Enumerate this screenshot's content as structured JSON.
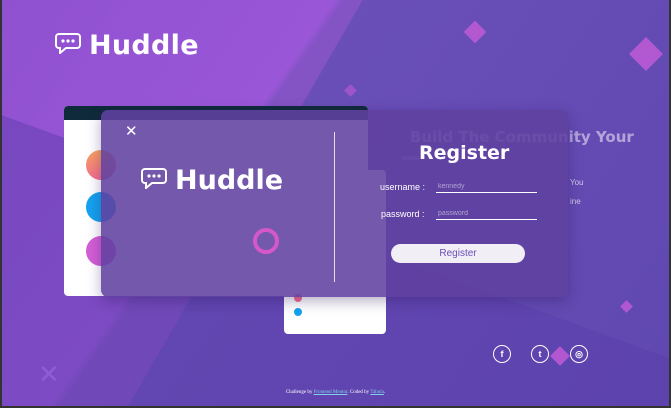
{
  "brand": {
    "name": "Huddle",
    "icon": "chat-bubble-icon"
  },
  "background_content": {
    "heading": "Build The Community Your",
    "text_lines": [
      "You",
      "ine"
    ]
  },
  "modal": {
    "close_icon": "close-icon",
    "brand_name": "Huddle",
    "title": "Register",
    "username_label": "username :",
    "username_placeholder": "kennedy",
    "password_label": "password :",
    "password_placeholder": "password",
    "submit_label": "Register"
  },
  "social": [
    {
      "icon": "facebook-icon",
      "glyph": "f"
    },
    {
      "icon": "twitter-icon",
      "glyph": "t"
    },
    {
      "icon": "instagram-icon",
      "glyph": "◎"
    }
  ],
  "attribution": {
    "prefix": "Challenge by",
    "challenge_link": "Frontend Mentor",
    "middle": ". Coded by",
    "author_link": "Tabula",
    "suffix": "."
  },
  "colors": {
    "accent": "#d557c8",
    "background": "#6a4fb8",
    "button": "#f1eef6"
  }
}
